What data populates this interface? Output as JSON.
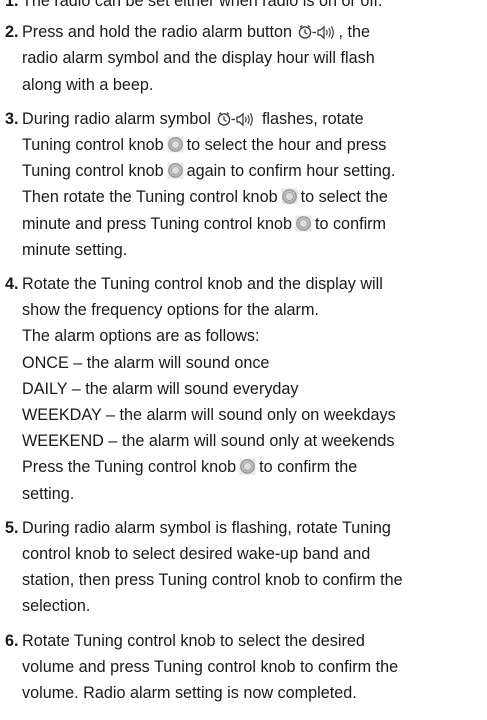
{
  "steps": [
    {
      "num": "1.",
      "lines": [
        "The radio can be set either when radio is on or off."
      ]
    },
    {
      "num": "2.",
      "line1_a": "Press and hold the radio alarm button",
      "line1_b": ", the",
      "lines": [
        "radio alarm symbol and the display hour will flash",
        "along with a beep."
      ]
    },
    {
      "num": "3.",
      "line1_a": "During radio alarm symbol",
      "line1_b": "flashes, rotate",
      "line2_a": "Tuning control knob",
      "line2_b": "to select the hour and press",
      "line3_a": "Tuning control knob",
      "line3_b": "again to confirm hour setting.",
      "line4_a": "Then rotate the Tuning control knob",
      "line4_b": "to select the",
      "line5_a": "minute and press Tuning control knob",
      "line5_b": "to confirm",
      "line6": "minute setting."
    },
    {
      "num": "4.",
      "lines": [
        "Rotate the Tuning control knob and the display will",
        "show the frequency options for the alarm.",
        "The alarm options are as follows:",
        "ONCE – the alarm will sound once",
        "DAILY – the alarm will sound everyday",
        "WEEKDAY – the alarm will sound only on weekdays",
        "WEEKEND – the alarm will sound only at weekends"
      ],
      "last_a": "Press the Tuning control knob",
      "last_b": "to confirm the",
      "last_c": "setting."
    },
    {
      "num": "5.",
      "lines": [
        "During radio alarm symbol is flashing, rotate Tuning",
        "control knob to select desired wake-up band and",
        "station, then press Tuning control knob to confirm the",
        "selection."
      ]
    },
    {
      "num": "6.",
      "lines": [
        "Rotate Tuning control knob to select the desired",
        "volume and press Tuning control knob to confirm the",
        "volume. Radio alarm setting is now completed."
      ]
    }
  ],
  "icons": {
    "alarm": "radio-alarm-icon",
    "knob": "tuning-knob-icon"
  }
}
